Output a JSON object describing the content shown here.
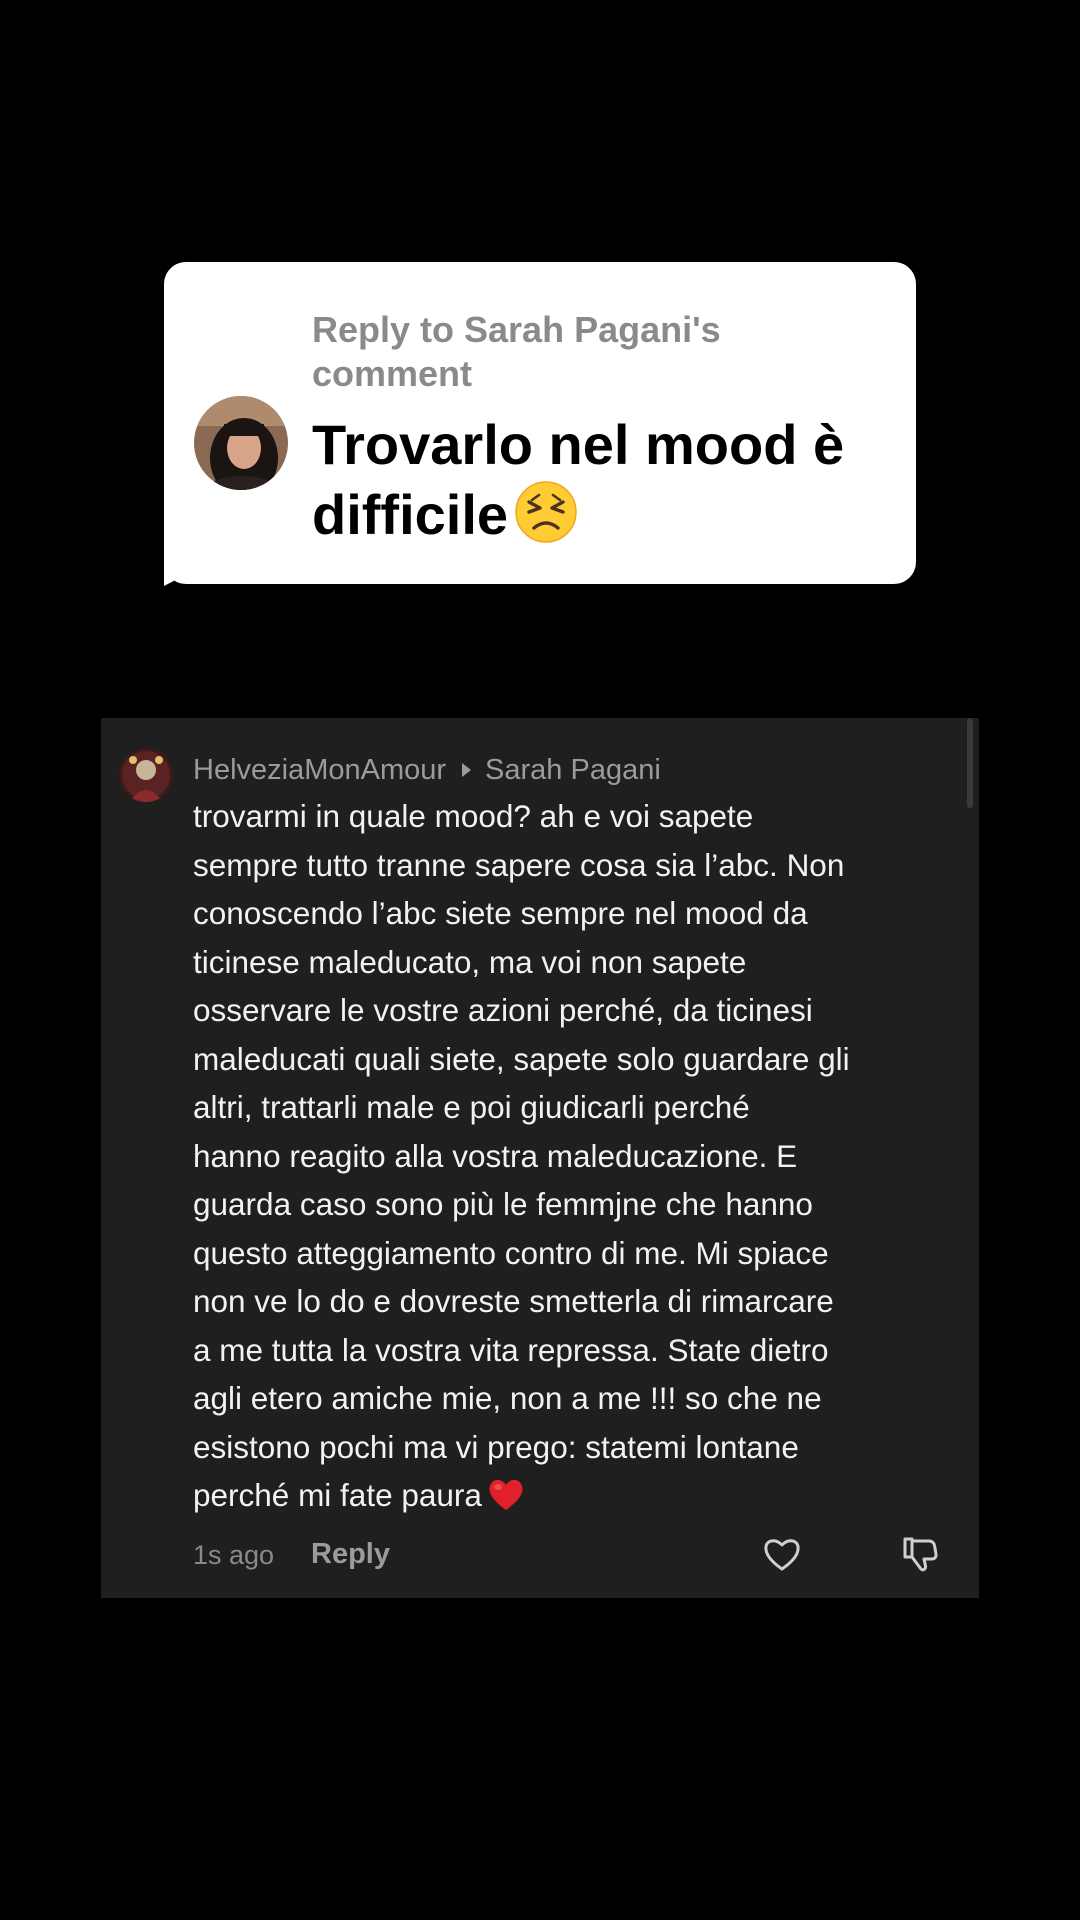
{
  "reply_bubble": {
    "header": "Reply to Sarah Pagani's comment",
    "text": "Trovarlo nel mood è difficile",
    "emoji": "tired-face-emoji"
  },
  "comment": {
    "username": "HelveziaMonAmour",
    "reply_target": "Sarah Pagani",
    "text": "trovarmi in quale mood? ah e voi sapete\nsempre tutto tranne sapere cosa sia l’abc. Non\nconoscendo l’abc siete sempre nel mood da\nticinese maleducato, ma voi non sapete\nosservare le vostre azioni perché, da ticinesi\nmaleducati quali siete, sapete solo guardare gli\naltri, trattarli male e poi giudicarli perché\nhanno reagito alla vostra maleducazione. E\nguarda caso sono più le femmjne che hanno\nquesto atteggiamento contro di me. Mi spiace\nnon ve lo do e dovreste smetterla di rimarcare\na me tutta la vostra vita repressa. State dietro\nagli etero amiche mie, non a me !!! so che ne\nesistono pochi ma vi prego: statemi lontane\nperché mi fate paura",
    "trailing_emoji": "red-heart-emoji",
    "time": "1s ago",
    "reply_label": "Reply",
    "like_icon": "heart-outline-icon",
    "dislike_icon": "thumbs-down-icon"
  },
  "colors": {
    "background": "#000000",
    "bubble": "#ffffff",
    "card": "#1f1f1f",
    "muted_text": "#9b9b9b",
    "heart": "#e0202a"
  }
}
